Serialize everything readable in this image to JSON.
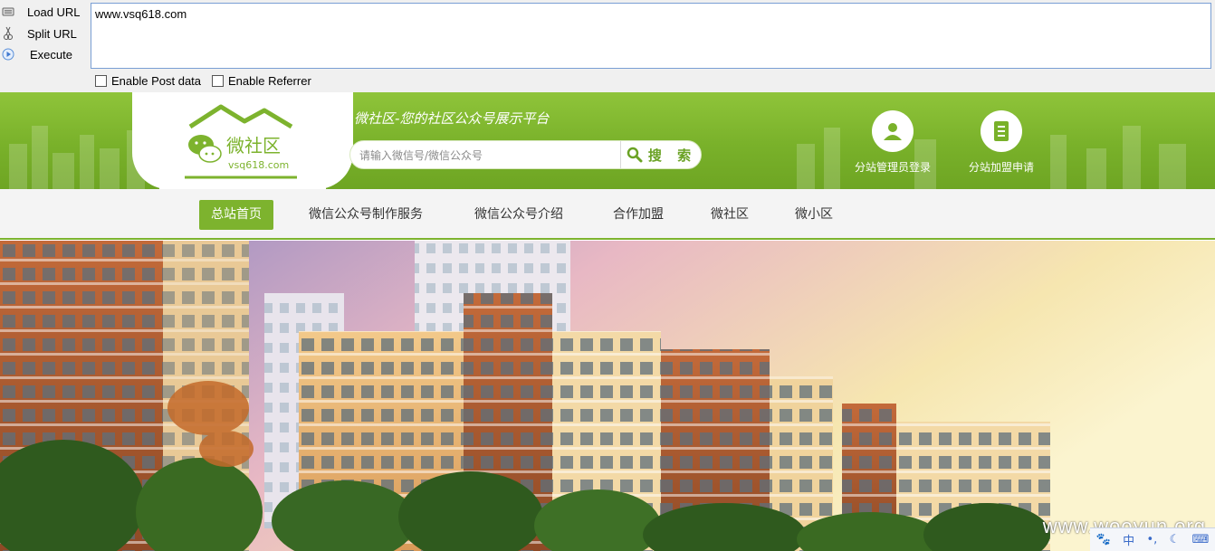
{
  "toolbar": {
    "load_url": "Load URL",
    "split_url": "Split URL",
    "execute": "Execute",
    "url_value": "www.vsq618.com",
    "enable_post": "Enable Post data",
    "enable_referrer": "Enable Referrer"
  },
  "header": {
    "logo_name": "微社区",
    "logo_domain": "vsq618.com",
    "slogan": "微社区-您的社区公众号展示平台",
    "search_placeholder": "请输入微信号/微信公众号",
    "search_button": "搜 索",
    "admin_login": "分站管理员登录",
    "join_apply": "分站加盟申请"
  },
  "nav": {
    "items": [
      {
        "label": "总站首页",
        "active": true
      },
      {
        "label": "微信公众号制作服务"
      },
      {
        "label": "微信公众号介绍"
      },
      {
        "label": "合作加盟"
      },
      {
        "label": "微社区"
      },
      {
        "label": "微小区"
      }
    ]
  },
  "banner": {
    "watermark": "www.wooyun.org",
    "ime": {
      "cn": "中"
    }
  },
  "colors": {
    "brand_green": "#7db32e",
    "header_green": "#79b12a",
    "url_border": "#7a9fd4"
  },
  "icons": {
    "load": "load-url-icon",
    "split": "split-url-icon",
    "execute": "execute-icon",
    "search": "search-icon",
    "admin": "user-icon",
    "join": "document-icon"
  }
}
